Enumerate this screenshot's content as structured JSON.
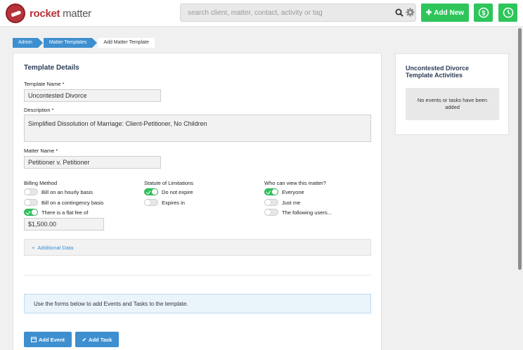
{
  "header": {
    "logo_word1": "rocket",
    "logo_word2": "matter",
    "search_placeholder": "search client, matter, contact, activity or tag",
    "add_new_label": "Add New",
    "icons": [
      "search-icon",
      "gear-icon",
      "plus-icon",
      "dollar-icon",
      "clock-icon"
    ]
  },
  "breadcrumb": [
    "Admin",
    "Matter Templates",
    "Add Matter Template"
  ],
  "form": {
    "section_title": "Template Details",
    "template_name_label": "Template Name *",
    "template_name_value": "Uncontested Divorce",
    "description_label": "Description *",
    "description_value": "Simplified Dissolution of Marriage:  Client-Petitioner, No Children",
    "matter_name_label": "Matter Name *",
    "matter_name_value": "Petitioner v. Petitioner",
    "billing": {
      "heading": "Billing Method",
      "options": [
        {
          "label": "Bill on an hourly basis",
          "on": false
        },
        {
          "label": "Bill on a contingency basis",
          "on": false
        },
        {
          "label": "There is a flat fee of",
          "on": true
        }
      ],
      "flat_fee_value": "$1,500.00"
    },
    "statute": {
      "heading": "Statute of Limitations",
      "options": [
        {
          "label": "Do not expire",
          "on": true
        },
        {
          "label": "Expires in",
          "on": false
        }
      ]
    },
    "visibility": {
      "heading": "Who can view this matter?",
      "options": [
        {
          "label": "Everyone",
          "on": true
        },
        {
          "label": "Just me",
          "on": false
        },
        {
          "label": "The following users...",
          "on": false
        }
      ]
    },
    "additional_data_label": "Additional Data",
    "info_text": "Use the forms below to add Events and Tasks to the template.",
    "add_event_label": "Add Event",
    "add_task_label": "Add Task"
  },
  "sidebar": {
    "title": "Uncontested Divorce Template Activities",
    "empty_text": "No events or tasks have been added"
  },
  "colors": {
    "brand_red": "#b7333a",
    "accent_green": "#2ec55b",
    "accent_blue": "#3d8fd0",
    "heading_navy": "#2c3e57"
  }
}
